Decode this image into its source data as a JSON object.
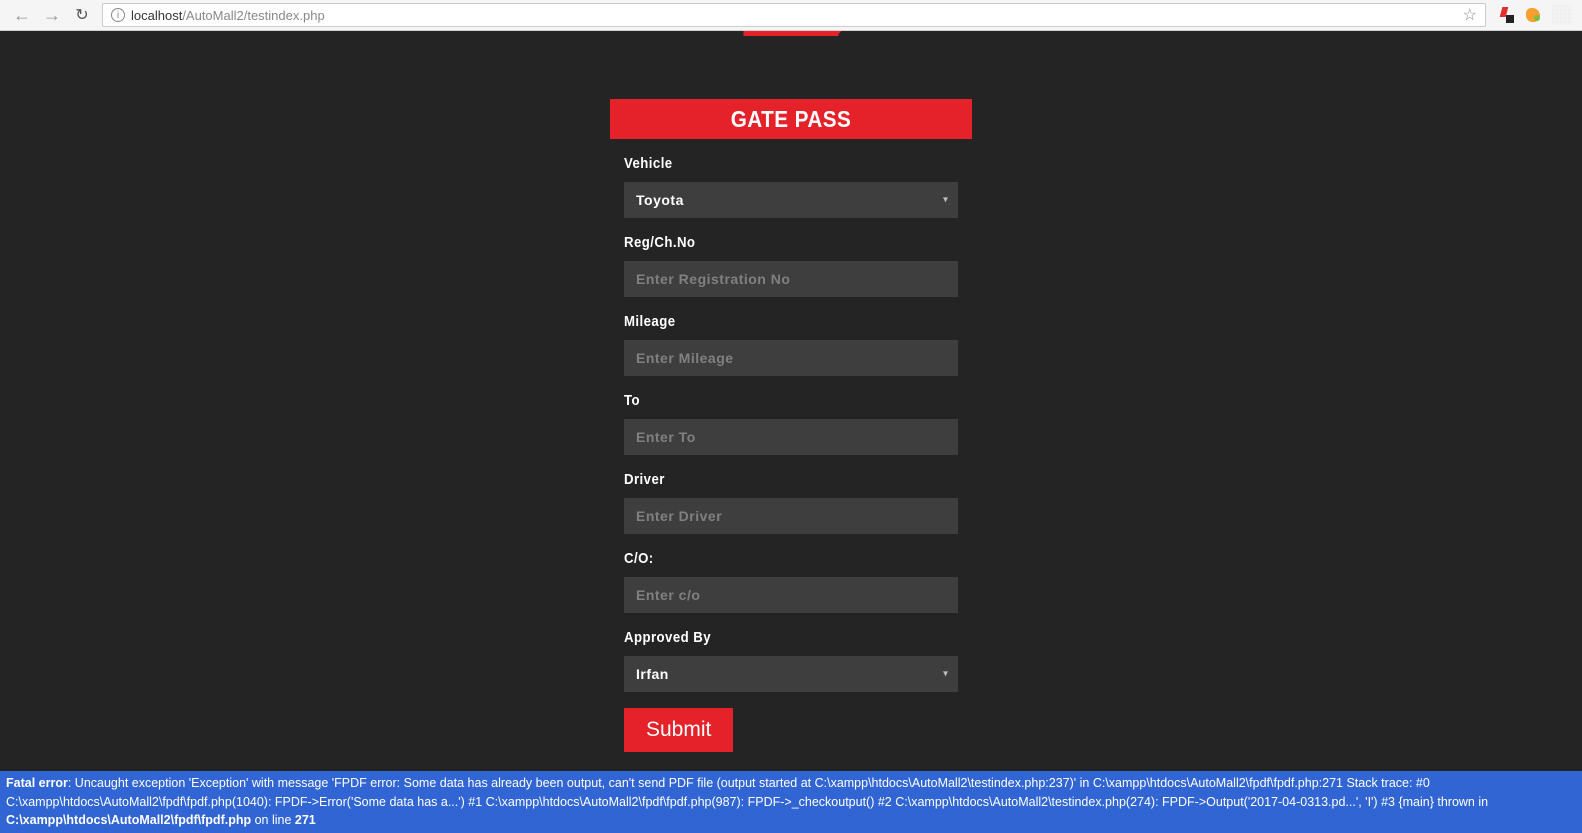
{
  "browser": {
    "url_host": "localhost",
    "url_path": "/AutoMall2/testindex.php"
  },
  "form": {
    "title": "GATE PASS",
    "vehicle": {
      "label": "Vehicle",
      "value": "Toyota"
    },
    "reg": {
      "label": "Reg/Ch.No",
      "placeholder": "Enter Registration No"
    },
    "mileage": {
      "label": "Mileage",
      "placeholder": "Enter Mileage"
    },
    "to": {
      "label": "To",
      "placeholder": "Enter To"
    },
    "driver": {
      "label": "Driver",
      "placeholder": "Enter Driver"
    },
    "co": {
      "label": "C/O:",
      "placeholder": "Enter c/o"
    },
    "approved": {
      "label": "Approved By",
      "value": "Irfan"
    },
    "submit": "Submit"
  },
  "error": {
    "prefix": "Fatal error",
    "msg1": ": Uncaught exception 'Exception' with message 'FPDF error: Some data has already been output, can't send PDF file (output started at C:\\xampp\\htdocs\\AutoMall2\\testindex.php:237)' in C:\\xampp\\htdocs\\AutoMall2\\fpdf\\fpdf.php:271 Stack trace: #0 C:\\xampp\\htdocs\\AutoMall2\\fpdf\\fpdf.php(1040): FPDF->Error('Some data has a...') #1 C:\\xampp\\htdocs\\AutoMall2\\fpdf\\fpdf.php(987): FPDF->_checkoutput() #2 C:\\xampp\\htdocs\\AutoMall2\\testindex.php(274): FPDF->Output('2017-04-0313.pd...', 'I') #3 {main} thrown in ",
    "file": "C:\\xampp\\htdocs\\AutoMall2\\fpdf\\fpdf.php",
    "msg2": " on line ",
    "line": "271"
  }
}
